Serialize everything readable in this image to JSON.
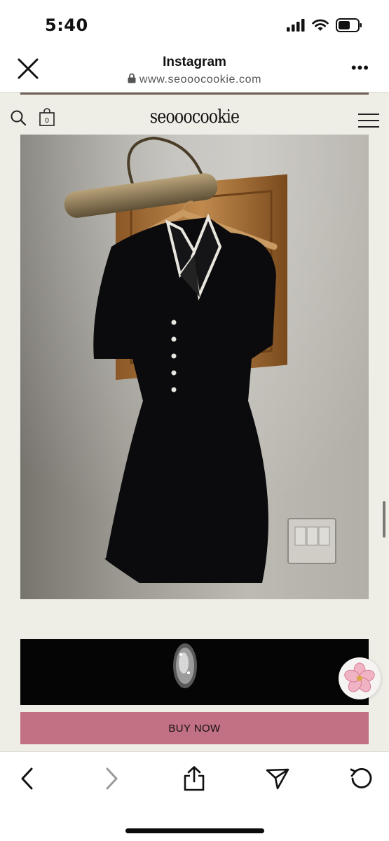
{
  "status_bar": {
    "time": "5:40",
    "icons": [
      "cellular-signal-icon",
      "wifi-icon",
      "battery-icon"
    ]
  },
  "browser": {
    "title": "Instagram",
    "url": "www.seooocookie.com",
    "icons": [
      "close-icon",
      "lock-icon",
      "more-icon"
    ]
  },
  "site": {
    "logo": "seooocookie",
    "cart_count": "0",
    "icons": [
      "search-icon",
      "cart-icon",
      "menu-icon",
      "flower-icon"
    ],
    "buy_button": "BUY NOW"
  },
  "bottom_nav": {
    "icons": [
      "back-icon",
      "forward-icon",
      "share-icon",
      "send-icon",
      "reload-icon"
    ]
  },
  "colors": {
    "page_background": "#efeee6",
    "buy_button": "#c27083"
  }
}
